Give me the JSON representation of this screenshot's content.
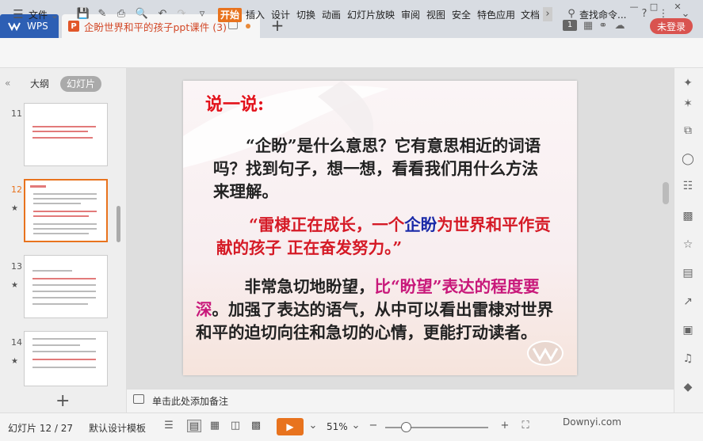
{
  "titlebar": {
    "app_tab": "WPS",
    "doc_tab": "企盼世界和平的孩子ppt课件 (3)",
    "new_tab": "+",
    "badge": "1",
    "login": "未登录"
  },
  "ribbon": {
    "file_menu": "文件",
    "tabs": [
      "开始",
      "插入",
      "设计",
      "切换",
      "动画",
      "幻灯片放映",
      "审阅",
      "视图",
      "安全",
      "特色应用",
      "文档"
    ],
    "search": "查找命令...",
    "help": "?"
  },
  "left_panel": {
    "tabs": [
      "大纲",
      "幻灯片"
    ],
    "thumbnails": [
      {
        "num": "11"
      },
      {
        "num": "12"
      },
      {
        "num": "13"
      },
      {
        "num": "14"
      }
    ],
    "add": "+"
  },
  "slide": {
    "heading": "说一说:",
    "para1": "“企盼”是什么意思？它有意思相近的词语吗？找到句子，想一想，看看我们用什么方法来理解。",
    "quote_a": "“雷棣正在成长，一个",
    "quote_b": "企盼",
    "quote_c": "为世界和平作贡献的孩子  正在奋发努力。”",
    "para3_a": "非常急切地盼望，",
    "para3_b": "比“盼望”表达的程度要深",
    "para3_c": "。加强了表达的语气，从中可以看出雷棣对世界和平的迫切向往和急切的心情，更能打动读者。"
  },
  "notes": {
    "placeholder": "单击此处添加备注"
  },
  "status": {
    "slide_count": "幻灯片 12 / 27",
    "theme": "默认设计模板",
    "zoom": "51%",
    "watermark": "Downyi.com"
  },
  "colors": {
    "accent": "#e8731e",
    "title_red": "#e3121b",
    "login_red": "#d9534f",
    "wps_blue": "#2d5fb4"
  }
}
